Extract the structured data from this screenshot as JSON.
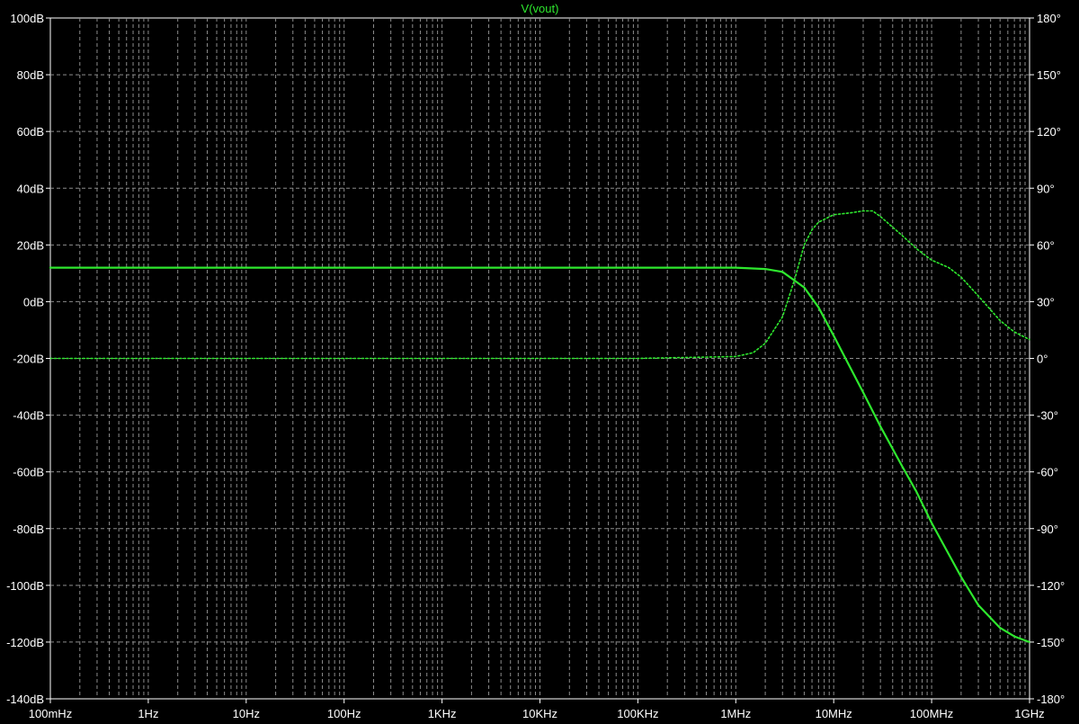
{
  "chart_data": {
    "type": "line",
    "title": "V(vout)",
    "x_scale": "log",
    "xlim": [
      0.1,
      1000000000
    ],
    "x_tick_labels": [
      "100mHz",
      "1Hz",
      "10Hz",
      "100Hz",
      "1KHz",
      "10KHz",
      "100KHz",
      "1MHz",
      "10MHz",
      "100MHz",
      "1GHz"
    ],
    "ylim": [
      -140,
      100
    ],
    "y_tick_labels": [
      "100dB",
      "80dB",
      "60dB",
      "40dB",
      "20dB",
      "0dB",
      "-20dB",
      "-40dB",
      "-60dB",
      "-80dB",
      "-100dB",
      "-120dB",
      "-140dB"
    ],
    "y2lim": [
      -180,
      180
    ],
    "y2_tick_labels": [
      "180°",
      "150°",
      "120°",
      "90°",
      "60°",
      "30°",
      "0°",
      "-30°",
      "-60°",
      "-90°",
      "-120°",
      "-150°",
      "-180°"
    ],
    "grid": true,
    "background_color": "#000000",
    "grid_color": "#8c8c8c",
    "series": [
      {
        "role": "magnitude",
        "axis": "left",
        "style": "solid",
        "color": "#2ee82e",
        "x": [
          0.1,
          1,
          10,
          100,
          1000,
          10000,
          100000,
          1000000,
          2000000,
          3000000,
          5000000,
          7000000,
          10000000,
          20000000,
          30000000,
          50000000,
          70000000,
          100000000,
          200000000,
          300000000,
          500000000,
          700000000,
          1000000000
        ],
        "values": [
          12,
          12,
          12,
          12,
          12,
          12,
          12,
          12,
          11.5,
          10.5,
          5,
          -2,
          -12,
          -32,
          -44,
          -58,
          -67,
          -78,
          -97,
          -107,
          -115,
          -118,
          -120
        ]
      },
      {
        "role": "phase",
        "axis": "right",
        "style": "dotted",
        "color": "#2ee82e",
        "x": [
          0.1,
          1,
          10,
          100,
          1000,
          10000,
          100000,
          1000000,
          1500000,
          2000000,
          3000000,
          4000000,
          5000000,
          6000000,
          7000000,
          10000000,
          15000000,
          20000000,
          25000000,
          30000000,
          50000000,
          70000000,
          100000000,
          150000000,
          200000000,
          300000000,
          500000000,
          700000000,
          1000000000
        ],
        "values": [
          0,
          0,
          0,
          0,
          0,
          0,
          0,
          1,
          3,
          8,
          22,
          42,
          60,
          68,
          72,
          76,
          77,
          78,
          78,
          75,
          65,
          58,
          52,
          48,
          43,
          33,
          20,
          14,
          10
        ]
      }
    ]
  }
}
